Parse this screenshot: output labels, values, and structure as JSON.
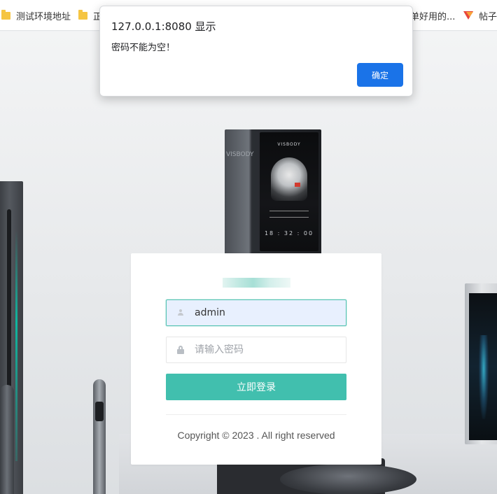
{
  "bookmarks": {
    "item1_label": "测试环境地址",
    "item2_label": "正",
    "item3_label": "单好用的...",
    "item4_label": "帖子"
  },
  "alert": {
    "origin": "127.0.0.1:8080 显示",
    "message": "密码不能为空！",
    "ok_label": "确定"
  },
  "device": {
    "brand": "VISBODY",
    "vertical_text": "VISBODY",
    "clock": "18 : 32 : 00"
  },
  "login": {
    "username_value": "admin",
    "password_placeholder": "请输入密码",
    "submit_label": "立即登录",
    "copyright": "Copyright © 2023 . All right reserved"
  },
  "colors": {
    "accent": "#41bfae",
    "dialog_button": "#1a73e8"
  }
}
